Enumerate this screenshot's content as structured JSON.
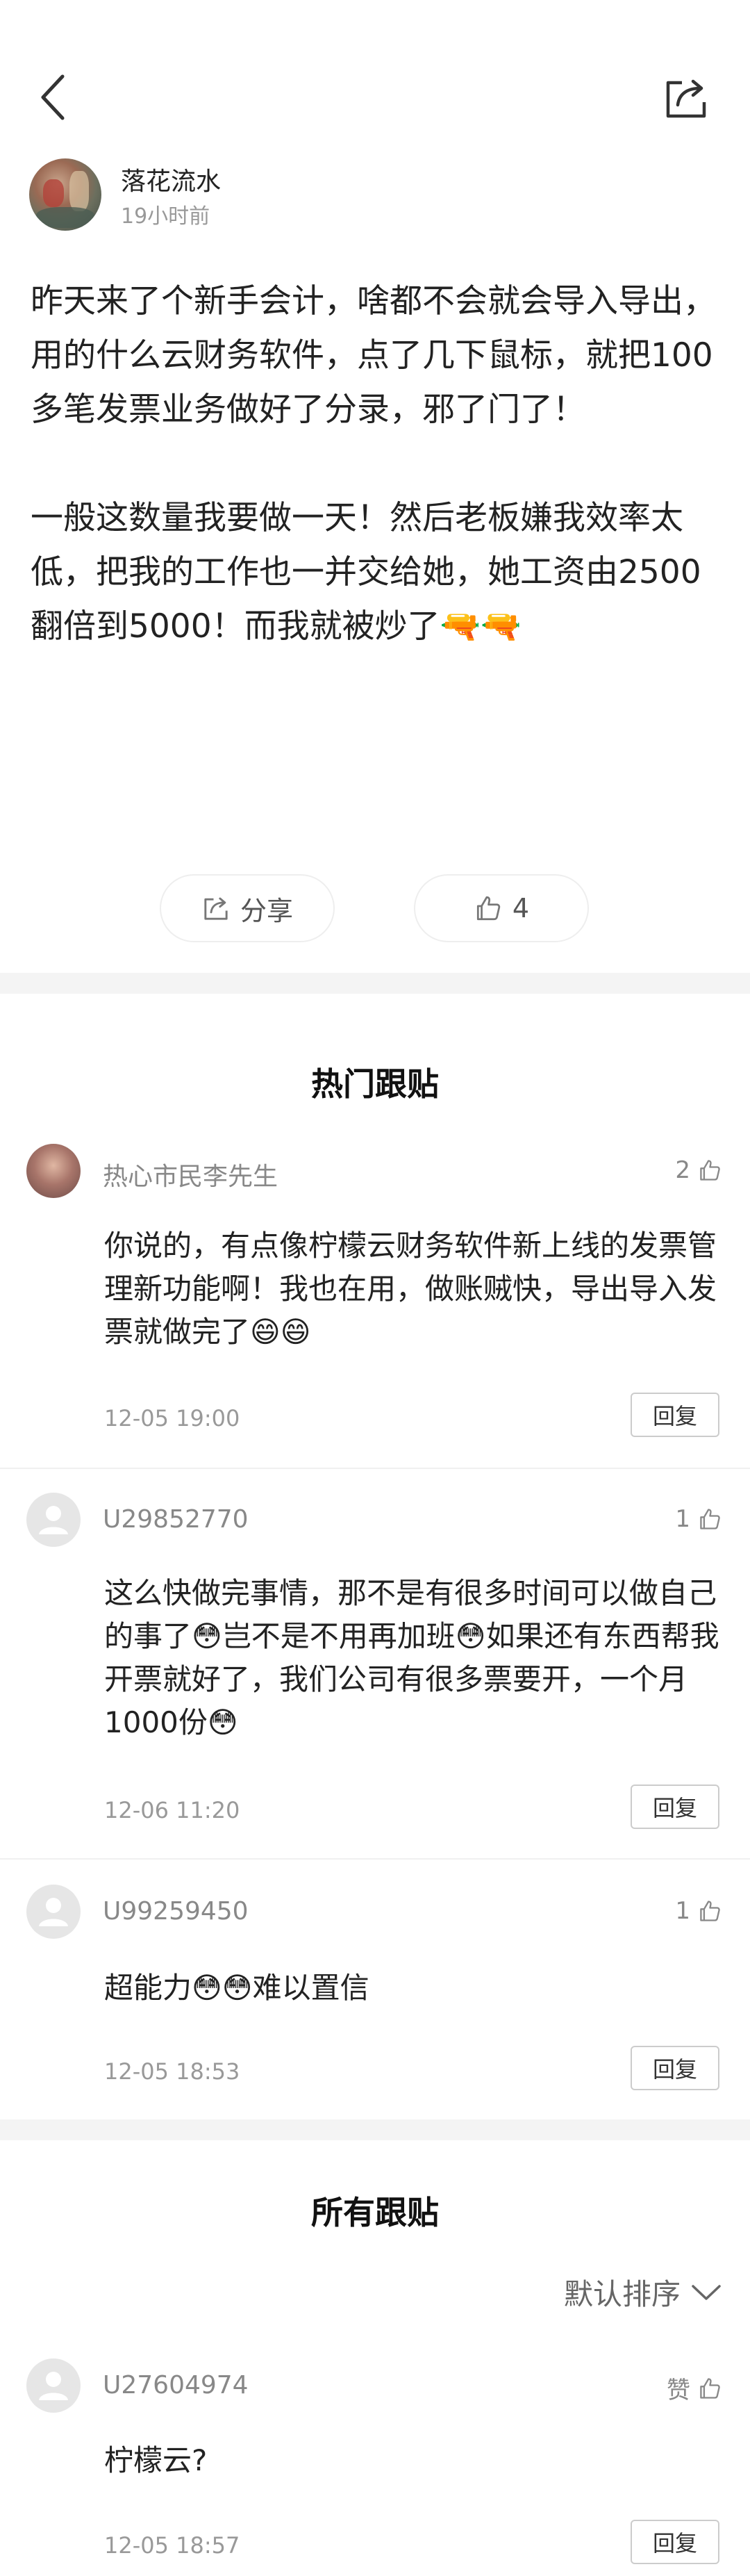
{
  "author": {
    "name": "落花流水",
    "time": "19小时前"
  },
  "post": {
    "text": "昨天来了个新手会计，啥都不会就会导入导出，用的什么云财务软件，点了几下鼠标，就把100多笔发票业务做好了分录，邪了门了！\n\n一般这数量我要做一天！然后老板嫌我效率太低，把我的工作也一并交给她，她工资由2500翻倍到5000！而我就被炒了🔫🔫"
  },
  "actions": {
    "share_label": "分享",
    "like_count": "4"
  },
  "hot": {
    "title": "热门跟贴",
    "comments": [
      {
        "user": "热心市民李先生",
        "likes": "2",
        "text": "你说的，有点像柠檬云财务软件新上线的发票管理新功能啊！我也在用，做账贼快，导出导入发票就做完了😄😄",
        "time": "12-05 19:00",
        "reply": "回复"
      },
      {
        "user": "U29852770",
        "likes": "1",
        "text": "这么快做完事情，那不是有很多时间可以做自己的事了😳岂不是不用再加班😳如果还有东西帮我开票就好了，我们公司有很多票要开，一个月1000份😳",
        "time": "12-06 11:20",
        "reply": "回复"
      },
      {
        "user": "U99259450",
        "likes": "1",
        "text": "超能力😳😳难以置信",
        "time": "12-05 18:53",
        "reply": "回复"
      }
    ]
  },
  "all": {
    "title": "所有跟贴",
    "sort_label": "默认排序",
    "comments": [
      {
        "user": "U27604974",
        "likes": "赞",
        "text": "柠檬云?",
        "time": "12-05 18:57",
        "reply": "回复"
      }
    ]
  },
  "colors": {
    "text_primary": "#222222",
    "text_muted": "#999999",
    "divider": "#f4f4f4"
  },
  "icons": [
    "back-arrow-icon",
    "share-icon",
    "thumbs-up-icon",
    "default-avatar-icon",
    "chevron-down-icon"
  ]
}
